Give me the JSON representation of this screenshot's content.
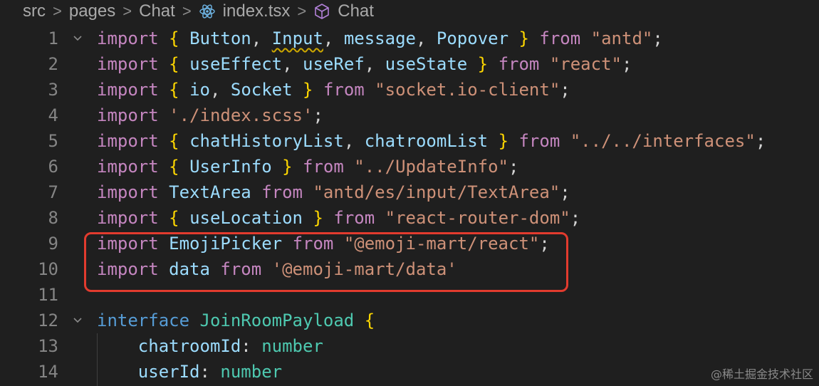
{
  "breadcrumb": {
    "items": [
      "src",
      "pages",
      "Chat",
      "index.tsx",
      "Chat"
    ],
    "separator": ">",
    "icons": [
      "react-file-icon",
      "component-cube-icon"
    ]
  },
  "editor": {
    "highlight_color": "#e23b2e",
    "lines": [
      {
        "number": "1",
        "fold": true,
        "tokens": [
          {
            "t": "import",
            "c": "kw-import"
          },
          {
            "t": " ",
            "c": "pn"
          },
          {
            "t": "{",
            "c": "br"
          },
          {
            "t": " ",
            "c": "pn"
          },
          {
            "t": "Button",
            "c": "id"
          },
          {
            "t": ", ",
            "c": "pn"
          },
          {
            "t": "Input",
            "c": "id",
            "squiggle": true
          },
          {
            "t": ", ",
            "c": "pn"
          },
          {
            "t": "message",
            "c": "id"
          },
          {
            "t": ", ",
            "c": "pn"
          },
          {
            "t": "Popover",
            "c": "id"
          },
          {
            "t": " ",
            "c": "pn"
          },
          {
            "t": "}",
            "c": "br"
          },
          {
            "t": " ",
            "c": "pn"
          },
          {
            "t": "from",
            "c": "kw-import"
          },
          {
            "t": " ",
            "c": "pn"
          },
          {
            "t": "\"antd\"",
            "c": "str"
          },
          {
            "t": ";",
            "c": "pn"
          }
        ]
      },
      {
        "number": "2",
        "fold": false,
        "tokens": [
          {
            "t": "import",
            "c": "kw-import"
          },
          {
            "t": " ",
            "c": "pn"
          },
          {
            "t": "{",
            "c": "br"
          },
          {
            "t": " ",
            "c": "pn"
          },
          {
            "t": "useEffect",
            "c": "id"
          },
          {
            "t": ", ",
            "c": "pn"
          },
          {
            "t": "useRef",
            "c": "id"
          },
          {
            "t": ", ",
            "c": "pn"
          },
          {
            "t": "useState",
            "c": "id"
          },
          {
            "t": " ",
            "c": "pn"
          },
          {
            "t": "}",
            "c": "br"
          },
          {
            "t": " ",
            "c": "pn"
          },
          {
            "t": "from",
            "c": "kw-import"
          },
          {
            "t": " ",
            "c": "pn"
          },
          {
            "t": "\"react\"",
            "c": "str"
          },
          {
            "t": ";",
            "c": "pn"
          }
        ]
      },
      {
        "number": "3",
        "fold": false,
        "tokens": [
          {
            "t": "import",
            "c": "kw-import"
          },
          {
            "t": " ",
            "c": "pn"
          },
          {
            "t": "{",
            "c": "br"
          },
          {
            "t": " ",
            "c": "pn"
          },
          {
            "t": "io",
            "c": "id"
          },
          {
            "t": ", ",
            "c": "pn"
          },
          {
            "t": "Socket",
            "c": "id"
          },
          {
            "t": " ",
            "c": "pn"
          },
          {
            "t": "}",
            "c": "br"
          },
          {
            "t": " ",
            "c": "pn"
          },
          {
            "t": "from",
            "c": "kw-import"
          },
          {
            "t": " ",
            "c": "pn"
          },
          {
            "t": "\"socket.io-client\"",
            "c": "str"
          },
          {
            "t": ";",
            "c": "pn"
          }
        ]
      },
      {
        "number": "4",
        "fold": false,
        "tokens": [
          {
            "t": "import",
            "c": "kw-import"
          },
          {
            "t": " ",
            "c": "pn"
          },
          {
            "t": "'./index.scss'",
            "c": "str"
          },
          {
            "t": ";",
            "c": "pn"
          }
        ]
      },
      {
        "number": "5",
        "fold": false,
        "tokens": [
          {
            "t": "import",
            "c": "kw-import"
          },
          {
            "t": " ",
            "c": "pn"
          },
          {
            "t": "{",
            "c": "br"
          },
          {
            "t": " ",
            "c": "pn"
          },
          {
            "t": "chatHistoryList",
            "c": "id"
          },
          {
            "t": ", ",
            "c": "pn"
          },
          {
            "t": "chatroomList",
            "c": "id"
          },
          {
            "t": " ",
            "c": "pn"
          },
          {
            "t": "}",
            "c": "br"
          },
          {
            "t": " ",
            "c": "pn"
          },
          {
            "t": "from",
            "c": "kw-import"
          },
          {
            "t": " ",
            "c": "pn"
          },
          {
            "t": "\"../../interfaces\"",
            "c": "str"
          },
          {
            "t": ";",
            "c": "pn"
          }
        ]
      },
      {
        "number": "6",
        "fold": false,
        "tokens": [
          {
            "t": "import",
            "c": "kw-import"
          },
          {
            "t": " ",
            "c": "pn"
          },
          {
            "t": "{",
            "c": "br"
          },
          {
            "t": " ",
            "c": "pn"
          },
          {
            "t": "UserInfo",
            "c": "id"
          },
          {
            "t": " ",
            "c": "pn"
          },
          {
            "t": "}",
            "c": "br"
          },
          {
            "t": " ",
            "c": "pn"
          },
          {
            "t": "from",
            "c": "kw-import"
          },
          {
            "t": " ",
            "c": "pn"
          },
          {
            "t": "\"../UpdateInfo\"",
            "c": "str"
          },
          {
            "t": ";",
            "c": "pn"
          }
        ]
      },
      {
        "number": "7",
        "fold": false,
        "tokens": [
          {
            "t": "import",
            "c": "kw-import"
          },
          {
            "t": " ",
            "c": "pn"
          },
          {
            "t": "TextArea",
            "c": "id"
          },
          {
            "t": " ",
            "c": "pn"
          },
          {
            "t": "from",
            "c": "kw-import"
          },
          {
            "t": " ",
            "c": "pn"
          },
          {
            "t": "\"antd/es/input/TextArea\"",
            "c": "str"
          },
          {
            "t": ";",
            "c": "pn"
          }
        ]
      },
      {
        "number": "8",
        "fold": false,
        "tokens": [
          {
            "t": "import",
            "c": "kw-import"
          },
          {
            "t": " ",
            "c": "pn"
          },
          {
            "t": "{",
            "c": "br"
          },
          {
            "t": " ",
            "c": "pn"
          },
          {
            "t": "useLocation",
            "c": "id"
          },
          {
            "t": " ",
            "c": "pn"
          },
          {
            "t": "}",
            "c": "br"
          },
          {
            "t": " ",
            "c": "pn"
          },
          {
            "t": "from",
            "c": "kw-import"
          },
          {
            "t": " ",
            "c": "pn"
          },
          {
            "t": "\"react-router-dom\"",
            "c": "str"
          },
          {
            "t": ";",
            "c": "pn"
          }
        ]
      },
      {
        "number": "9",
        "fold": false,
        "tokens": [
          {
            "t": "import",
            "c": "kw-import"
          },
          {
            "t": " ",
            "c": "pn"
          },
          {
            "t": "EmojiPicker",
            "c": "id"
          },
          {
            "t": " ",
            "c": "pn"
          },
          {
            "t": "from",
            "c": "kw-import"
          },
          {
            "t": " ",
            "c": "pn"
          },
          {
            "t": "\"@emoji-mart/react\"",
            "c": "str"
          },
          {
            "t": ";",
            "c": "pn"
          }
        ]
      },
      {
        "number": "10",
        "fold": false,
        "tokens": [
          {
            "t": "import",
            "c": "kw-import"
          },
          {
            "t": " ",
            "c": "pn"
          },
          {
            "t": "data",
            "c": "id"
          },
          {
            "t": " ",
            "c": "pn"
          },
          {
            "t": "from",
            "c": "kw-import"
          },
          {
            "t": " ",
            "c": "pn"
          },
          {
            "t": "'@emoji-mart/data'",
            "c": "str"
          }
        ]
      },
      {
        "number": "11",
        "fold": false,
        "tokens": []
      },
      {
        "number": "12",
        "fold": true,
        "tokens": [
          {
            "t": "interface",
            "c": "kw"
          },
          {
            "t": " ",
            "c": "pn"
          },
          {
            "t": "JoinRoomPayload",
            "c": "ty"
          },
          {
            "t": " ",
            "c": "pn"
          },
          {
            "t": "{",
            "c": "br"
          }
        ]
      },
      {
        "number": "13",
        "fold": false,
        "tokens": [
          {
            "t": "    ",
            "c": "pn"
          },
          {
            "t": "chatroomId",
            "c": "id"
          },
          {
            "t": ": ",
            "c": "pn"
          },
          {
            "t": "number",
            "c": "ty"
          }
        ]
      },
      {
        "number": "14",
        "fold": false,
        "tokens": [
          {
            "t": "    ",
            "c": "pn"
          },
          {
            "t": "userId",
            "c": "id"
          },
          {
            "t": ": ",
            "c": "pn"
          },
          {
            "t": "number",
            "c": "ty"
          }
        ]
      }
    ]
  },
  "watermark": "@稀土掘金技术社区"
}
